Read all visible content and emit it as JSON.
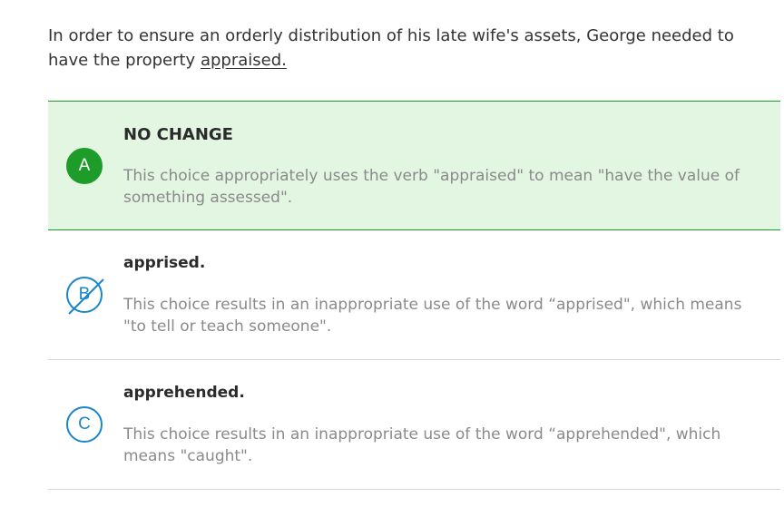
{
  "question": {
    "text_before": "In order to ensure an orderly distribution of his late wife's assets, George needed to have the property ",
    "underlined": "appraised."
  },
  "choices": [
    {
      "letter": "A",
      "title": "NO CHANGE",
      "description": "This choice appropriately uses the verb \"appraised\" to mean \"have the value of something assessed\".",
      "state": "correct"
    },
    {
      "letter": "B",
      "title": "apprised.",
      "description": "This choice results in an inappropriate use of the word “apprised\", which means \"to tell or teach someone\".",
      "state": "eliminated"
    },
    {
      "letter": "C",
      "title": "apprehended.",
      "description": "This choice results in an inappropriate use of the word “apprehended\", which means \"caught\".",
      "state": "default"
    }
  ],
  "colors": {
    "correct_green": "#1e9c2a",
    "correct_background": "#e2f6e2",
    "choice_blue": "#1a86c8"
  }
}
